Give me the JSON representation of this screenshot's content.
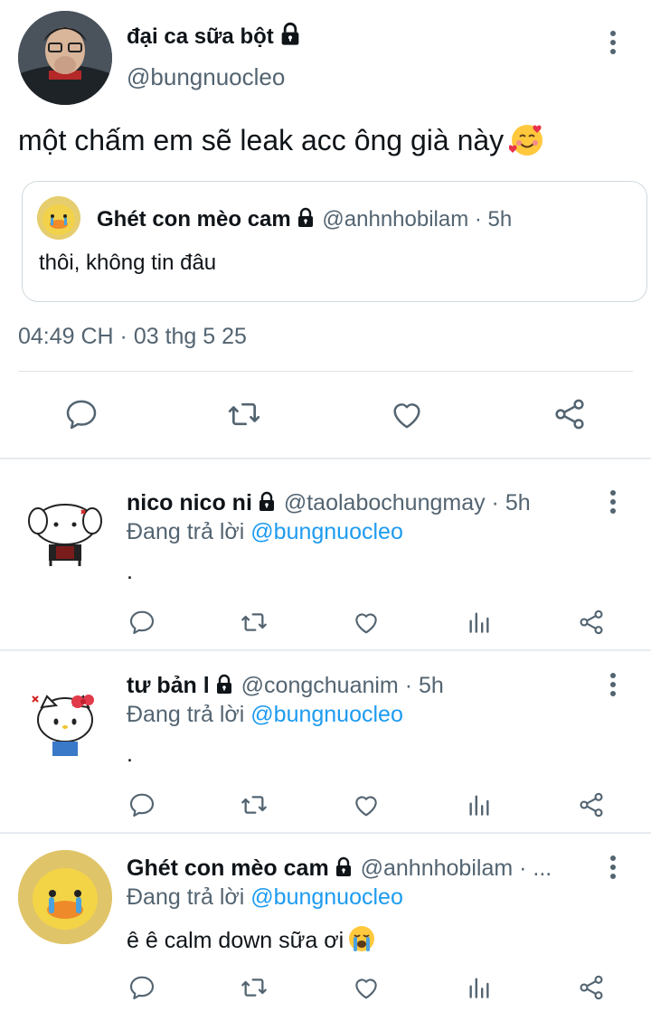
{
  "main_tweet": {
    "author_name": "đại ca sữa bột",
    "author_handle": "@bungnuocleo",
    "text": "một chấm em sẽ leak acc ông già này",
    "timestamp": "04:49 CH · 03 thg 5 25",
    "quoted": {
      "author_name": "Ghét con mèo cam",
      "meta": "@anhnhobilam · 5h",
      "text": "thôi, không tin đâu"
    }
  },
  "replies": [
    {
      "author_name": "nico nico ni",
      "meta": "@taolabochungmay · 5h",
      "replying_prefix": "Đang trả lời ",
      "replying_to": "@bungnuocleo",
      "text": "."
    },
    {
      "author_name": "tư bản l",
      "meta": "@congchuanim · 5h",
      "replying_prefix": "Đang trả lời ",
      "replying_to": "@bungnuocleo",
      "text": "."
    },
    {
      "author_name": "Ghét con mèo cam",
      "meta": "@anhnhobilam · ...",
      "replying_prefix": "Đang trả lời ",
      "replying_to": "@bungnuocleo",
      "text": "ê ê calm down sữa ơi"
    }
  ],
  "icons": {
    "reply": "speech-bubble-icon",
    "retweet": "retweet-icon",
    "like": "heart-icon",
    "views": "bar-chart-icon",
    "share": "share-icon",
    "more": "kebab-icon",
    "protected": "lock-icon"
  },
  "colors": {
    "text": "#0f1419",
    "secondary": "#536471",
    "link": "#1d9bf0",
    "divider": "#e6ebef"
  }
}
